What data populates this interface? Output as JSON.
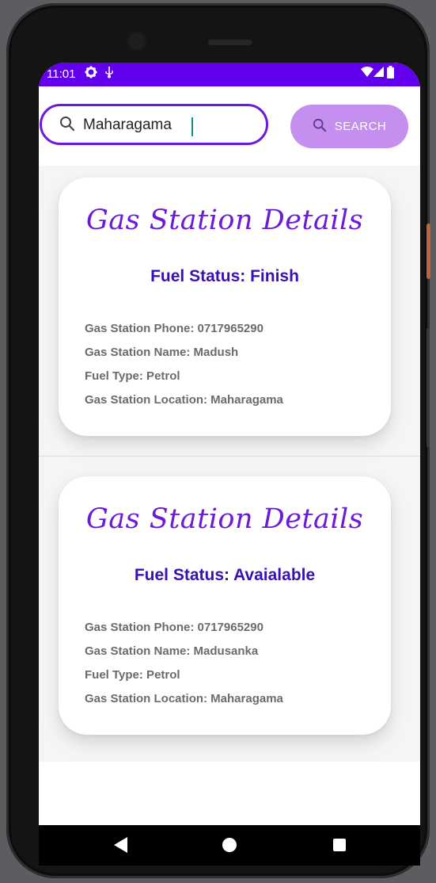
{
  "status_bar": {
    "time": "11:01",
    "icons": [
      "gear-icon",
      "usb-debug-icon",
      "wifi-icon",
      "signal-icon",
      "battery-icon"
    ],
    "color": "#6200ee"
  },
  "search": {
    "value": "Maharagama",
    "button_label": "SEARCH",
    "accent": "#6a1ad8",
    "button_color": "#c58ff0"
  },
  "stations": [
    {
      "title": "Gas Station Details",
      "fuel_status": "Fuel Status: Finish",
      "phone": "Gas Station Phone: 0717965290",
      "name": "Gas Station Name: Madush",
      "fuel_type": "Fuel Type: Petrol",
      "location": "Gas Station Location: Maharagama"
    },
    {
      "title": "Gas Station Details",
      "fuel_status": "Fuel Status: Avaialable",
      "phone": "Gas Station Phone: 0717965290",
      "name": "Gas Station Name: Madusanka",
      "fuel_type": "Fuel Type: Petrol",
      "location": "Gas Station Location: Maharagama"
    }
  ],
  "nav_bar": {
    "icons": [
      "back-icon",
      "home-icon",
      "recents-icon"
    ]
  }
}
